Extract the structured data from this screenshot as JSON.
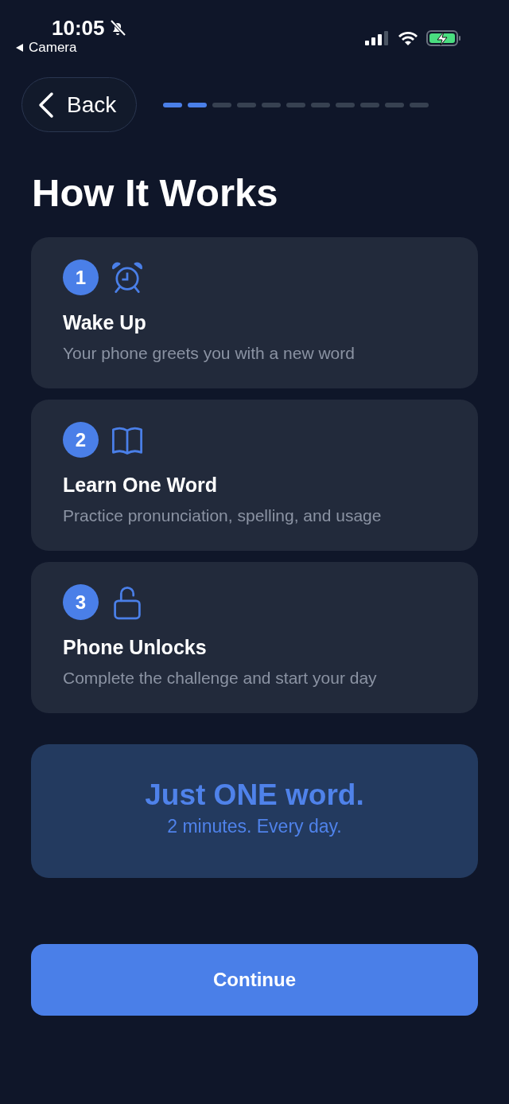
{
  "status_bar": {
    "time": "10:05",
    "back_app": "Camera"
  },
  "back_button": {
    "label": "Back"
  },
  "progress_steps": [
    {
      "done": true
    },
    {
      "done": true
    },
    {
      "done": false
    },
    {
      "done": false
    },
    {
      "done": false
    },
    {
      "done": false
    },
    {
      "done": false
    },
    {
      "done": false
    },
    {
      "done": false
    },
    {
      "done": false
    },
    {
      "done": false
    }
  ],
  "title": "How It Works",
  "steps": [
    {
      "number": "1",
      "kind": "alarm",
      "title": "Wake Up",
      "description": "Your phone greets you with a new word"
    },
    {
      "number": "2",
      "kind": "book",
      "title": "Learn One Word",
      "description": "Practice pronunciation, spelling, and usage"
    },
    {
      "number": "3",
      "kind": "lock",
      "title": "Phone Unlocks",
      "description": "Complete the challenge and start your day"
    }
  ],
  "highlight": {
    "headline": "Just ONE word.",
    "subline": "2 minutes. Every day."
  },
  "continue_button": {
    "label": "Continue"
  }
}
